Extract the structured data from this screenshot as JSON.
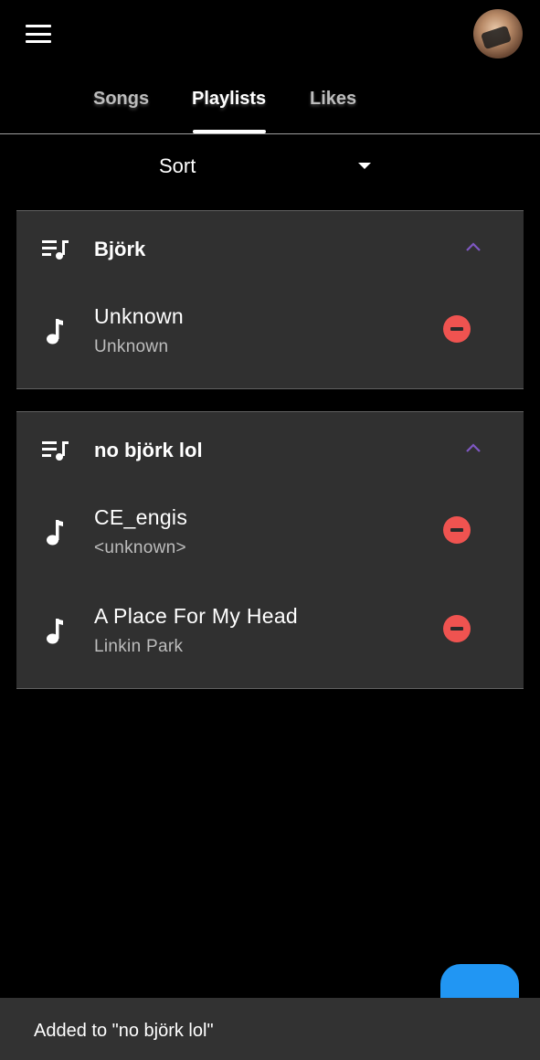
{
  "appbar": {
    "menu_icon": "menu-icon",
    "avatar_icon": "user-avatar"
  },
  "tabs": [
    {
      "label": "Songs",
      "active": false
    },
    {
      "label": "Playlists",
      "active": true
    },
    {
      "label": "Likes",
      "active": false
    }
  ],
  "sort": {
    "label": "Sort",
    "icon": "arrow-drop-down-icon"
  },
  "playlists": [
    {
      "name": "Björk",
      "expanded": true,
      "songs": [
        {
          "title": "Unknown",
          "artist": "Unknown"
        }
      ]
    },
    {
      "name": "no björk lol",
      "expanded": true,
      "songs": [
        {
          "title": "CE_engis",
          "artist": "<unknown>"
        },
        {
          "title": "A Place For My Head",
          "artist": "Linkin Park"
        }
      ]
    }
  ],
  "snackbar": {
    "message": "Added to \"no björk lol\""
  },
  "fab": {
    "icon": "add-icon"
  },
  "colors": {
    "background": "#000000",
    "card": "#303030",
    "remove": "#ef5350",
    "chevron": "#7e57c2",
    "fab": "#2196f3",
    "snackbar": "#323232"
  }
}
